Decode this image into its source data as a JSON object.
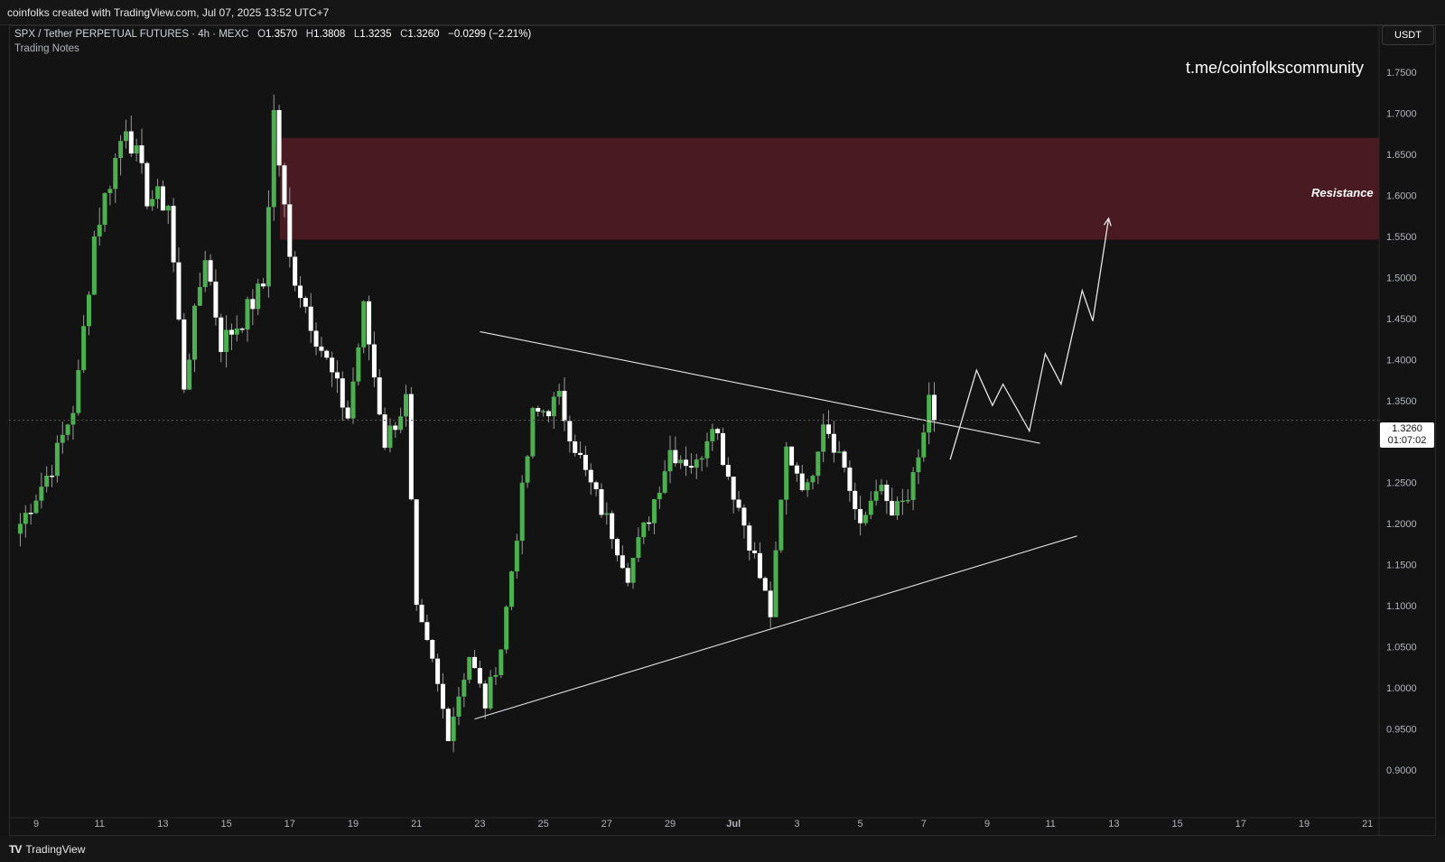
{
  "header": {
    "credit": "coinfolks created with TradingView.com, Jul 07, 2025 13:52 UTC+7"
  },
  "legend": {
    "symbol": "SPX / Tether PERPETUAL FUTURES · 4h · MEXC",
    "o_label": "O",
    "o_value": "1.3570",
    "h_label": "H",
    "h_value": "1.3808",
    "l_label": "L",
    "l_value": "1.3235",
    "c_label": "C",
    "c_value": "1.3260",
    "change": "−0.0299 (−2.21%)",
    "notes": "Trading Notes"
  },
  "watermark": "t.me/coinfolkscommunity",
  "currency": "USDT",
  "resistance_label": "Resistance",
  "price_tag": {
    "price": "1.3260",
    "countdown": "01:07:02"
  },
  "footer": {
    "logo_mark": "TV",
    "logo_text": "TradingView"
  },
  "colors": {
    "background": "#131313",
    "up_candle": "#4caf50",
    "down_candle": "#ffffff",
    "resistance_zone": "#4a1a22",
    "trendline": "#e6e6e6"
  },
  "chart_data": {
    "type": "candlestick",
    "title": "SPX / Tether PERPETUAL FUTURES · 4h · MEXC",
    "xlabel": "",
    "ylabel": "",
    "x_tick_labels": [
      "9",
      "11",
      "13",
      "15",
      "17",
      "19",
      "21",
      "23",
      "25",
      "27",
      "29",
      "Jul",
      "3",
      "5",
      "7",
      "9",
      "11",
      "13",
      "15",
      "17",
      "19",
      "21"
    ],
    "y_tick_labels": [
      "1.7500",
      "1.7000",
      "1.6500",
      "1.6000",
      "1.5500",
      "1.5000",
      "1.4500",
      "1.4000",
      "1.3500",
      "1.3000",
      "1.2500",
      "1.2000",
      "1.1500",
      "1.1000",
      "1.0500",
      "1.0000",
      "0.9500",
      "0.9000"
    ],
    "ylim": [
      0.875,
      1.78
    ],
    "x_range_days": [
      "2025-06-08",
      "2025-07-21"
    ],
    "grid": false,
    "last_close": 1.326,
    "resistance_zone": {
      "from": 1.546,
      "to": 1.67
    },
    "candle_waypoints": [
      {
        "date": "2025-06-08T12:00",
        "close": 1.2
      },
      {
        "date": "2025-06-09T12:00",
        "close": 1.27
      },
      {
        "date": "2025-06-10T06:00",
        "close": 1.35
      },
      {
        "date": "2025-06-10T20:00",
        "close": 1.55
      },
      {
        "date": "2025-06-11T20:00",
        "close": 1.69
      },
      {
        "date": "2025-06-12T12:00",
        "close": 1.6
      },
      {
        "date": "2025-06-13T04:00",
        "close": 1.59
      },
      {
        "date": "2025-06-13T16:00",
        "close": 1.37
      },
      {
        "date": "2025-06-14T08:00",
        "close": 1.53
      },
      {
        "date": "2025-06-14T20:00",
        "close": 1.42
      },
      {
        "date": "2025-06-15T12:00",
        "close": 1.45
      },
      {
        "date": "2025-06-16T04:00",
        "close": 1.49
      },
      {
        "date": "2025-06-16T12:00",
        "close": 1.7
      },
      {
        "date": "2025-06-17T00:00",
        "close": 1.52
      },
      {
        "date": "2025-06-17T20:00",
        "close": 1.43
      },
      {
        "date": "2025-06-18T20:00",
        "close": 1.33
      },
      {
        "date": "2025-06-19T08:00",
        "close": 1.46
      },
      {
        "date": "2025-06-20T00:00",
        "close": 1.3
      },
      {
        "date": "2025-06-20T16:00",
        "close": 1.35
      },
      {
        "date": "2025-06-21T00:00",
        "close": 1.09
      },
      {
        "date": "2025-06-21T12:00",
        "close": 1.03
      },
      {
        "date": "2025-06-22T00:00",
        "close": 0.945
      },
      {
        "date": "2025-06-22T16:00",
        "close": 1.04
      },
      {
        "date": "2025-06-23T04:00",
        "close": 0.98
      },
      {
        "date": "2025-06-23T16:00",
        "close": 1.05
      },
      {
        "date": "2025-06-24T16:00",
        "close": 1.33
      },
      {
        "date": "2025-06-25T12:00",
        "close": 1.35
      },
      {
        "date": "2025-06-26T08:00",
        "close": 1.26
      },
      {
        "date": "2025-06-27T04:00",
        "close": 1.19
      },
      {
        "date": "2025-06-27T16:00",
        "close": 1.14
      },
      {
        "date": "2025-06-28T08:00",
        "close": 1.21
      },
      {
        "date": "2025-06-29T00:00",
        "close": 1.29
      },
      {
        "date": "2025-06-29T20:00",
        "close": 1.27
      },
      {
        "date": "2025-06-30T08:00",
        "close": 1.33
      },
      {
        "date": "2025-06-30T20:00",
        "close": 1.26
      },
      {
        "date": "2025-07-01T12:00",
        "close": 1.18
      },
      {
        "date": "2025-07-02T04:00",
        "close": 1.09
      },
      {
        "date": "2025-07-02T16:00",
        "close": 1.29
      },
      {
        "date": "2025-07-03T08:00",
        "close": 1.24
      },
      {
        "date": "2025-07-03T20:00",
        "close": 1.33
      },
      {
        "date": "2025-07-04T12:00",
        "close": 1.27
      },
      {
        "date": "2025-07-05T00:00",
        "close": 1.19
      },
      {
        "date": "2025-07-05T12:00",
        "close": 1.25
      },
      {
        "date": "2025-07-06T00:00",
        "close": 1.21
      },
      {
        "date": "2025-07-06T12:00",
        "close": 1.23
      },
      {
        "date": "2025-07-06T20:00",
        "close": 1.27
      },
      {
        "date": "2025-07-07T04:00",
        "close": 1.357
      },
      {
        "date": "2025-07-07T08:00",
        "close": 1.326
      }
    ],
    "annotations": {
      "upper_trendline": [
        {
          "date": "2025-06-23T00:00",
          "price": 1.434
        },
        {
          "date": "2025-07-10T16:00",
          "price": 1.298
        }
      ],
      "lower_trendline": [
        {
          "date": "2025-06-22T20:00",
          "price": 0.962
        },
        {
          "date": "2025-07-11T20:00",
          "price": 1.185
        }
      ],
      "projection_path": [
        {
          "date": "2025-07-07T20:00",
          "price": 1.278
        },
        {
          "date": "2025-07-08T16:00",
          "price": 1.387
        },
        {
          "date": "2025-07-09T04:00",
          "price": 1.344
        },
        {
          "date": "2025-07-09T12:00",
          "price": 1.37
        },
        {
          "date": "2025-07-10T08:00",
          "price": 1.313
        },
        {
          "date": "2025-07-10T20:00",
          "price": 1.407
        },
        {
          "date": "2025-07-11T08:00",
          "price": 1.37
        },
        {
          "date": "2025-07-12T00:00",
          "price": 1.484
        },
        {
          "date": "2025-07-12T08:00",
          "price": 1.447
        },
        {
          "date": "2025-07-12T20:00",
          "price": 1.572
        }
      ]
    }
  }
}
